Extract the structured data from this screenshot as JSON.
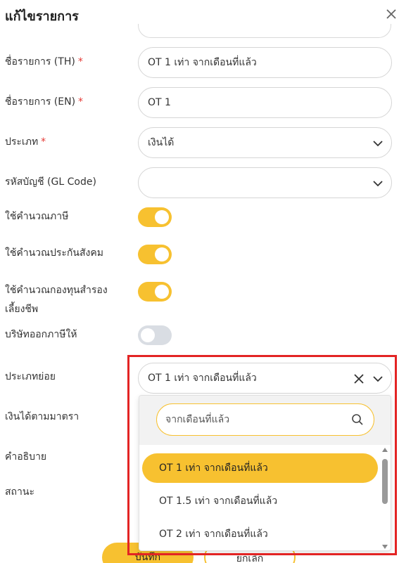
{
  "dialog": {
    "title": "แก้ไขรายการ"
  },
  "form": {
    "name_th": {
      "label": "ชื่อรายการ (TH)",
      "required": "*",
      "value": "OT 1 เท่า จากเดือนที่แล้ว"
    },
    "name_en": {
      "label": "ชื่อรายการ (EN)",
      "required": "*",
      "value": "OT 1"
    },
    "type": {
      "label": "ประเภท",
      "required": "*",
      "value": "เงินได้"
    },
    "gl_code": {
      "label": "รหัสบัญชี (GL Code)",
      "value": ""
    },
    "calc_tax": {
      "label": "ใช้คำนวณภาษี",
      "on": true
    },
    "calc_social": {
      "label": "ใช้คำนวณประกันสังคม",
      "on": true
    },
    "calc_fund_line1": "ใช้คำนวณกองทุนสำรอง",
    "calc_fund_line2": "เลี้ยงชีพ",
    "calc_fund_on": true,
    "company_tax": {
      "label": "บริษัทออกภาษีให้",
      "on": false
    },
    "subtype": {
      "label": "ประเภทย่อย",
      "value": "OT 1 เท่า จากเดือนที่แล้ว"
    },
    "income_section_label": "เงินได้ตามมาตรา",
    "description_label": "คำอธิบาย",
    "status_label": "สถานะ"
  },
  "dropdown": {
    "search_value": "จากเดือนที่แล้ว",
    "options": [
      {
        "label": "OT 1 เท่า จากเดือนที่แล้ว",
        "selected": true
      },
      {
        "label": "OT 1.5 เท่า จากเดือนที่แล้ว",
        "selected": false
      },
      {
        "label": "OT 2 เท่า จากเดือนที่แล้ว",
        "selected": false
      }
    ]
  },
  "buttons": {
    "save": "บันทึก",
    "cancel": "ยกเลิก"
  },
  "colors": {
    "accent": "#f7c130",
    "required": "#e53935",
    "highlight_border": "#e32424",
    "toggle_off": "#d9dde3"
  }
}
